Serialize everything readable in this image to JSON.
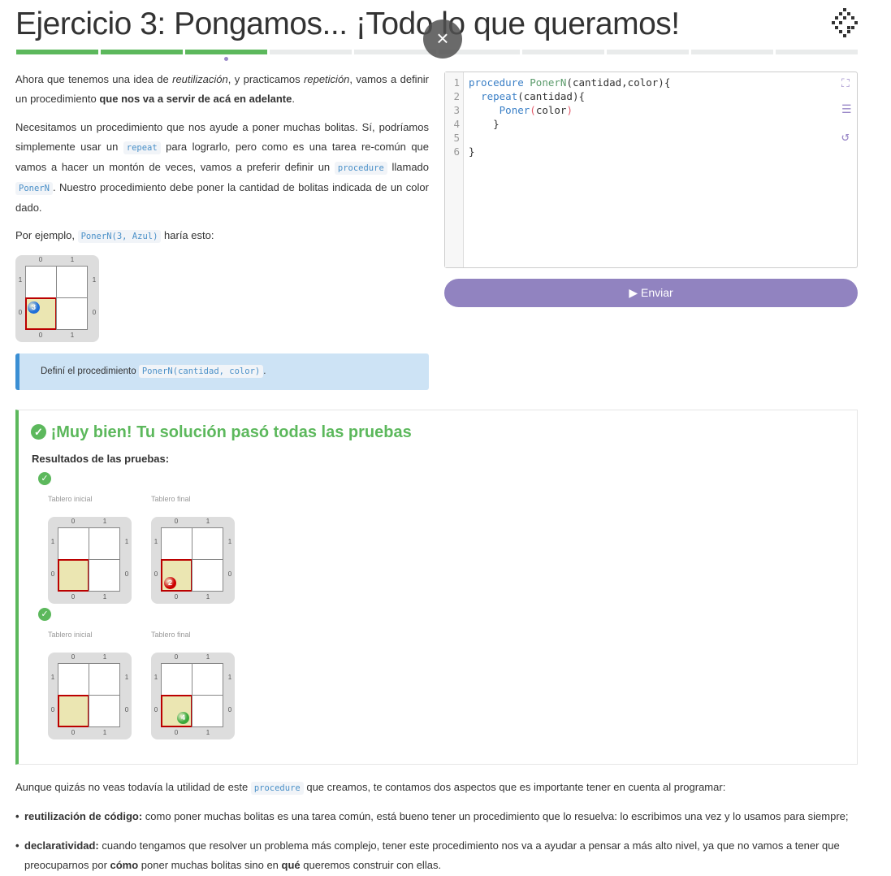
{
  "header": {
    "title": "Ejercicio 3: Pongamos... ¡Todo lo que queramos!",
    "close": "×",
    "progress": {
      "completed": 3,
      "total": 10,
      "current": 3
    }
  },
  "intro": {
    "p1": [
      "Ahora que tenemos una idea de ",
      "reutilización",
      ", y practicamos ",
      "repetición",
      ", vamos a definir un procedimiento ",
      "que nos va a servir de acá en adelante",
      "."
    ],
    "p2": [
      "Necesitamos un procedimiento que nos ayude a poner muchas bolitas. Sí, podríamos simplemente usar un ",
      "repeat",
      " para lograrlo, pero como es una tarea re-común que vamos a hacer un montón de veces, vamos a preferir definir un ",
      "procedure",
      " llamado ",
      "PonerN",
      ". Nuestro procedimiento debe poner la cantidad de bolitas indicada de un color dado."
    ],
    "p3": [
      "Por ejemplo, ",
      "PonerN(3, Azul)",
      " haría esto:"
    ]
  },
  "info": {
    "text": "Definí el procedimiento ",
    "code": "PonerN(cantidad, color)",
    "end": "."
  },
  "editor": {
    "line_numbers": [
      "1",
      "2",
      "3",
      "4",
      "5",
      "6"
    ],
    "tools": [
      "fullscreen-icon",
      "format-indent-icon",
      "reset-icon"
    ]
  },
  "send": {
    "label": "Enviar"
  },
  "boards": {
    "cols": [
      "0",
      "1"
    ],
    "rows": [
      "1",
      "0"
    ]
  },
  "example_board": {
    "ball": {
      "color": "#1e6fd9",
      "count": "3"
    }
  },
  "result": {
    "title": "¡Muy bien! Tu solución pasó todas las pruebas",
    "subtitle": "Resultados de las pruebas:",
    "initial_label": "Tablero inicial",
    "final_label": "Tablero final",
    "tests": [
      {
        "ball": {
          "color": "#c00",
          "count": "2"
        }
      },
      {
        "ball": {
          "color": "#3aa83a",
          "count": "4"
        }
      }
    ]
  },
  "outro": {
    "p": [
      "Aunque quizás no veas todavía la utilidad de este ",
      "procedure",
      " que creamos, te contamos dos aspectos que es importante tener en cuenta al programar:"
    ],
    "b1": [
      "reutilización de código:",
      " como poner muchas bolitas es una tarea común, está bueno tener un procedimiento que lo resuelva: lo escribimos una vez y lo usamos para siempre;"
    ],
    "b2": [
      "declaratividad:",
      " cuando tengamos que resolver un problema más complejo, tener este procedimiento nos va a ayudar a pensar a más alto nivel, ya que no vamos a tener que preocuparnos por ",
      "cómo",
      " poner muchas bolitas sino en ",
      "qué",
      " queremos construir con ellas."
    ]
  }
}
